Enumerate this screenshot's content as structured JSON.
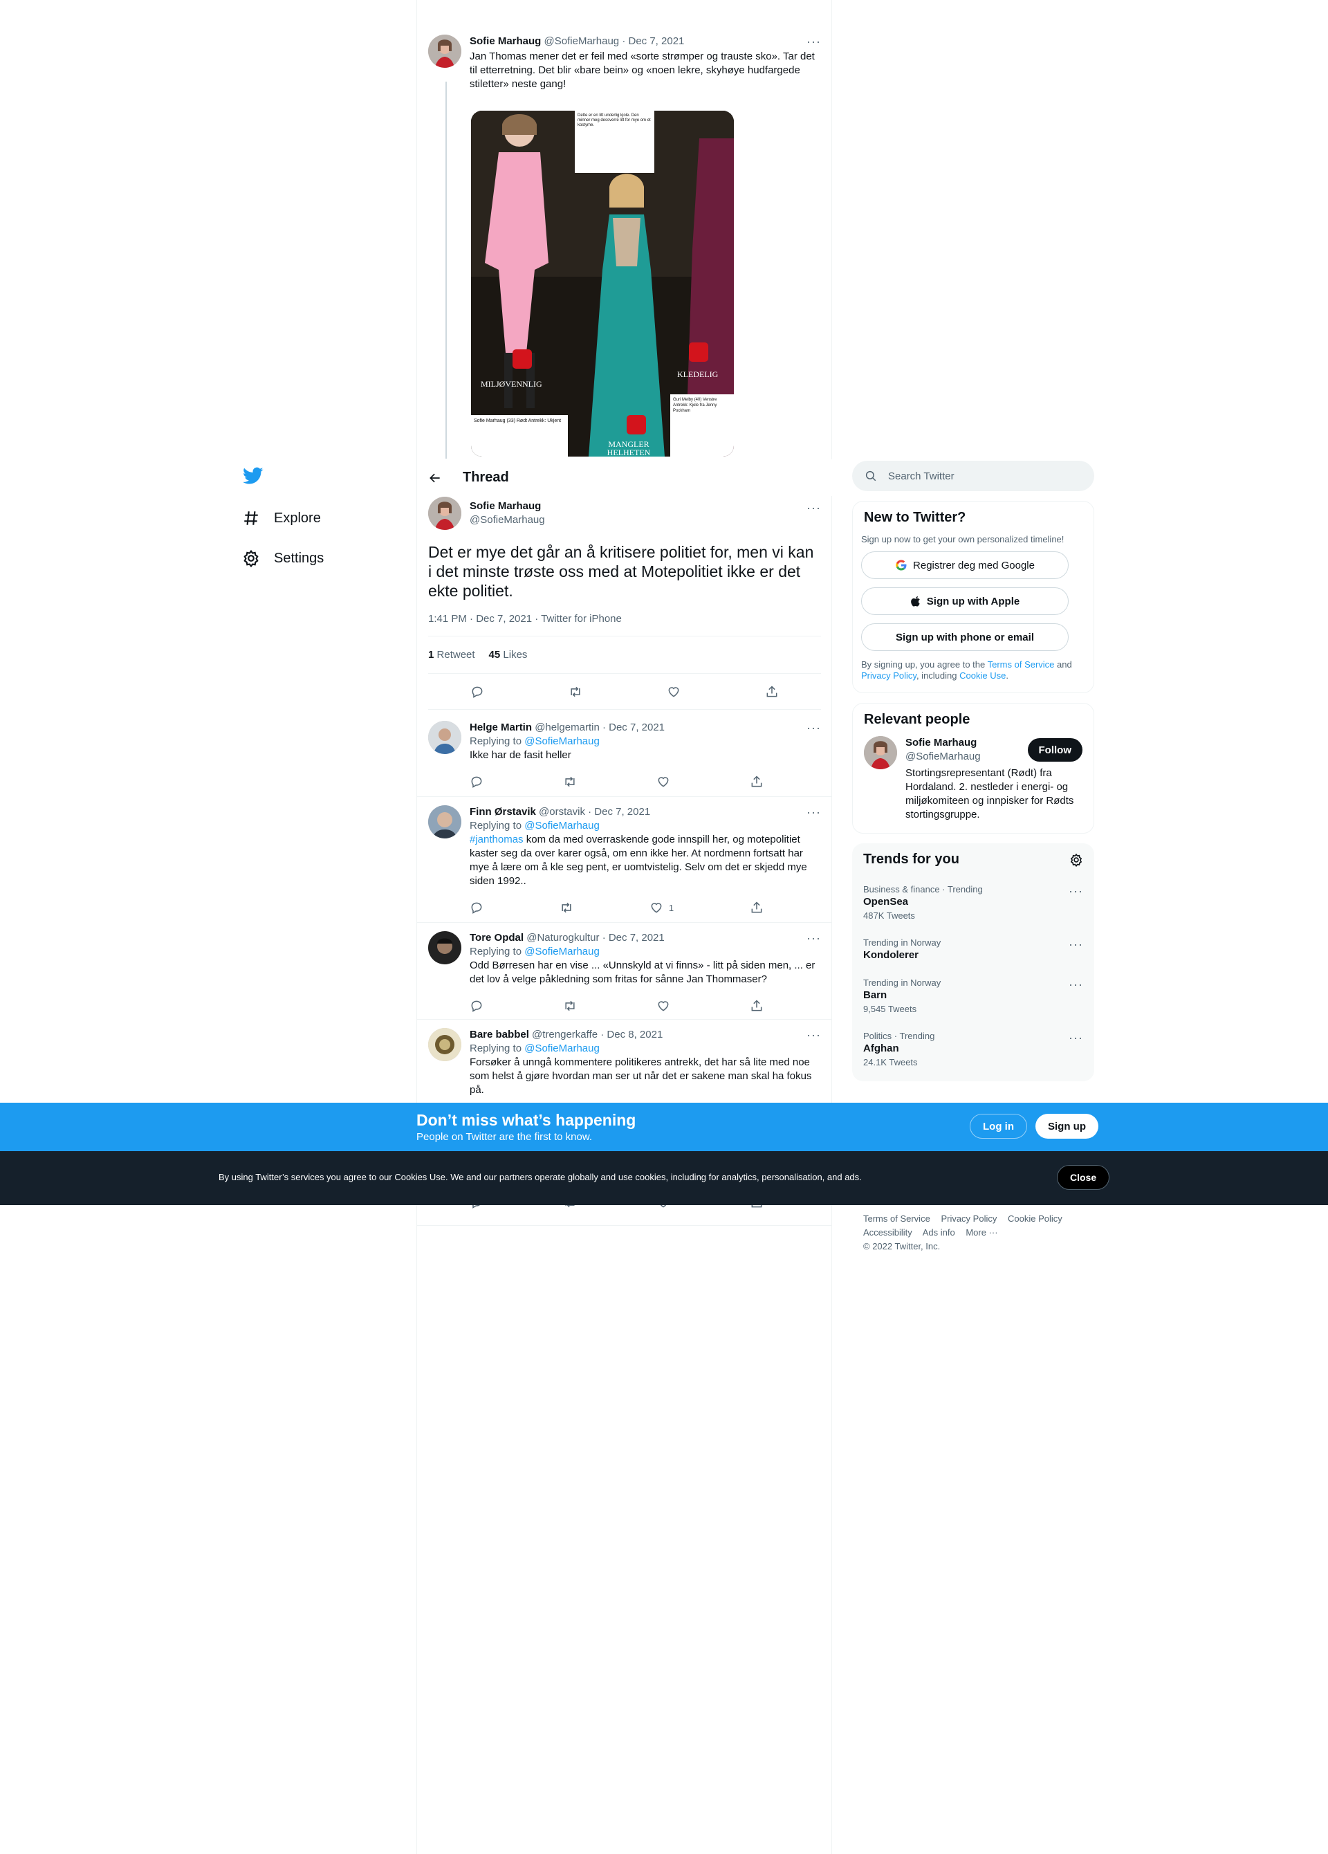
{
  "nav": {
    "explore": "Explore",
    "settings": "Settings"
  },
  "prev_tweet": {
    "name": "Sofie Marhaug",
    "handle": "@SofieMarhaug",
    "date": "· Dec 7, 2021",
    "text": "Jan Thomas mener det er feil med «sorte strømper og trauste sko». Tar det til etterretning. Det blir «bare bein» og «noen lekre, skyhøye hudfargede stiletter» neste gang!",
    "media_labels": [
      "MILJØVENNLIG",
      "MANGLER HELHETEN",
      "KLEDELIG"
    ],
    "media_caption_top": "Dette er en litt underlig kjole. Den minner meg dessverre litt for mye om et kostyme.",
    "media_caption_left": "Sofie Marhaug (33) Rødt Antrekk: Ukjent",
    "media_caption_right": "Guri Melby (40) Venstre Antrekk: Kjole fra Jenny Pockham"
  },
  "thread_header": {
    "title": "Thread"
  },
  "focal": {
    "name": "Sofie Marhaug",
    "handle": "@SofieMarhaug",
    "text": "Det er mye det går an å kritisere politiet for, men vi kan i det minste trøste oss med at Motepolitiet ikke er det ekte politiet.",
    "meta": "1:41 PM · Dec 7, 2021 · Twitter for iPhone",
    "retweets": "1",
    "retweets_label": "Retweet",
    "likes": "45",
    "likes_label": "Likes"
  },
  "replies": [
    {
      "name": "Helge Martin",
      "handle": "@helgemartin",
      "date": "· Dec 7, 2021",
      "replying": "Replying to",
      "to": "@SofieMarhaug",
      "hashtag": "",
      "text": "Ikke har de fasit heller",
      "likes": ""
    },
    {
      "name": "Finn Ørstavik",
      "handle": "@orstavik",
      "date": "· Dec 7, 2021",
      "replying": "Replying to",
      "to": "@SofieMarhaug",
      "hashtag": "#janthomas",
      "text": " kom da med overraskende gode innspill her, og motepolitiet kaster seg da over karer også, om enn ikke her. At nordmenn fortsatt har mye å lære om å kle seg pent, er uomtvistelig. Selv om det er skjedd mye siden 1992..",
      "likes": "1"
    },
    {
      "name": "Tore Opdal",
      "handle": "@Naturogkultur",
      "date": "· Dec 7, 2021",
      "replying": "Replying to",
      "to": "@SofieMarhaug",
      "hashtag": "",
      "text": "Odd Børresen har en vise ... «Unnskyld at vi finns» - litt på siden men, ... er det lov å velge påkledning som fritas for sånne Jan Thommaser?",
      "likes": ""
    },
    {
      "name": "Bare babbel",
      "handle": "@trengerkaffe",
      "date": "· Dec 8, 2021",
      "replying": "Replying to",
      "to": "@SofieMarhaug",
      "hashtag": "",
      "text": "Forsøker å unngå kommentere politikeres antrekk, det har så lite med noe som helst å gjøre hvordan man ser ut når det er sakene man skal ha fokus på.",
      "likes": ""
    }
  ],
  "right": {
    "search_placeholder": "Search Twitter",
    "new_title": "New to Twitter?",
    "new_sub": "Sign up now to get your own personalized timeline!",
    "btn_google": "Registrer deg med Google",
    "btn_apple": "Sign up with Apple",
    "btn_phone": "Sign up with phone or email",
    "legal_1": "By signing up, you agree to the ",
    "legal_terms": "Terms of Service",
    "legal_2": " and ",
    "legal_privacy": "Privacy Policy",
    "legal_3": ", including ",
    "legal_cookie": "Cookie Use",
    "legal_4": ".",
    "rp_title": "Relevant people",
    "rp_name": "Sofie Marhaug",
    "rp_handle": "@SofieMarhaug",
    "rp_follow": "Follow",
    "rp_bio": "Stortingsrepresentant (Rødt) fra Hordaland. 2. nestleder i energi- og miljøkomiteen og innpisker for Rødts stortingsgruppe.",
    "trends_title": "Trends for you",
    "trends": [
      {
        "ctx": "Business & finance · Trending",
        "name": "OpenSea",
        "count": "487K Tweets"
      },
      {
        "ctx": "Trending in Norway",
        "name": "Kondolerer",
        "count": ""
      },
      {
        "ctx": "Trending in Norway",
        "name": "Barn",
        "count": "9,545 Tweets"
      },
      {
        "ctx": "Politics · Trending",
        "name": "Afghan",
        "count": "24.1K Tweets"
      }
    ]
  },
  "footer": {
    "terms": "Terms of Service",
    "privacy": "Privacy Policy",
    "cookie": "Cookie Policy",
    "accessibility": "Accessibility",
    "ads": "Ads info",
    "more": "More ···",
    "copyright": "© 2022 Twitter, Inc."
  },
  "signup_bar": {
    "heading": "Don’t miss what’s happening",
    "sub": "People on Twitter are the first to know.",
    "login": "Log in",
    "signup": "Sign up"
  },
  "cookie_bar": {
    "text": "By using Twitter’s services you agree to our Cookies Use. We and our partners operate globally and use cookies, including for analytics, personalisation, and ads.",
    "close": "Close"
  },
  "colors": {
    "accent": "#1d9bf0",
    "text": "#0f1419",
    "muted": "#536471",
    "cookie_bg": "#15202b"
  }
}
